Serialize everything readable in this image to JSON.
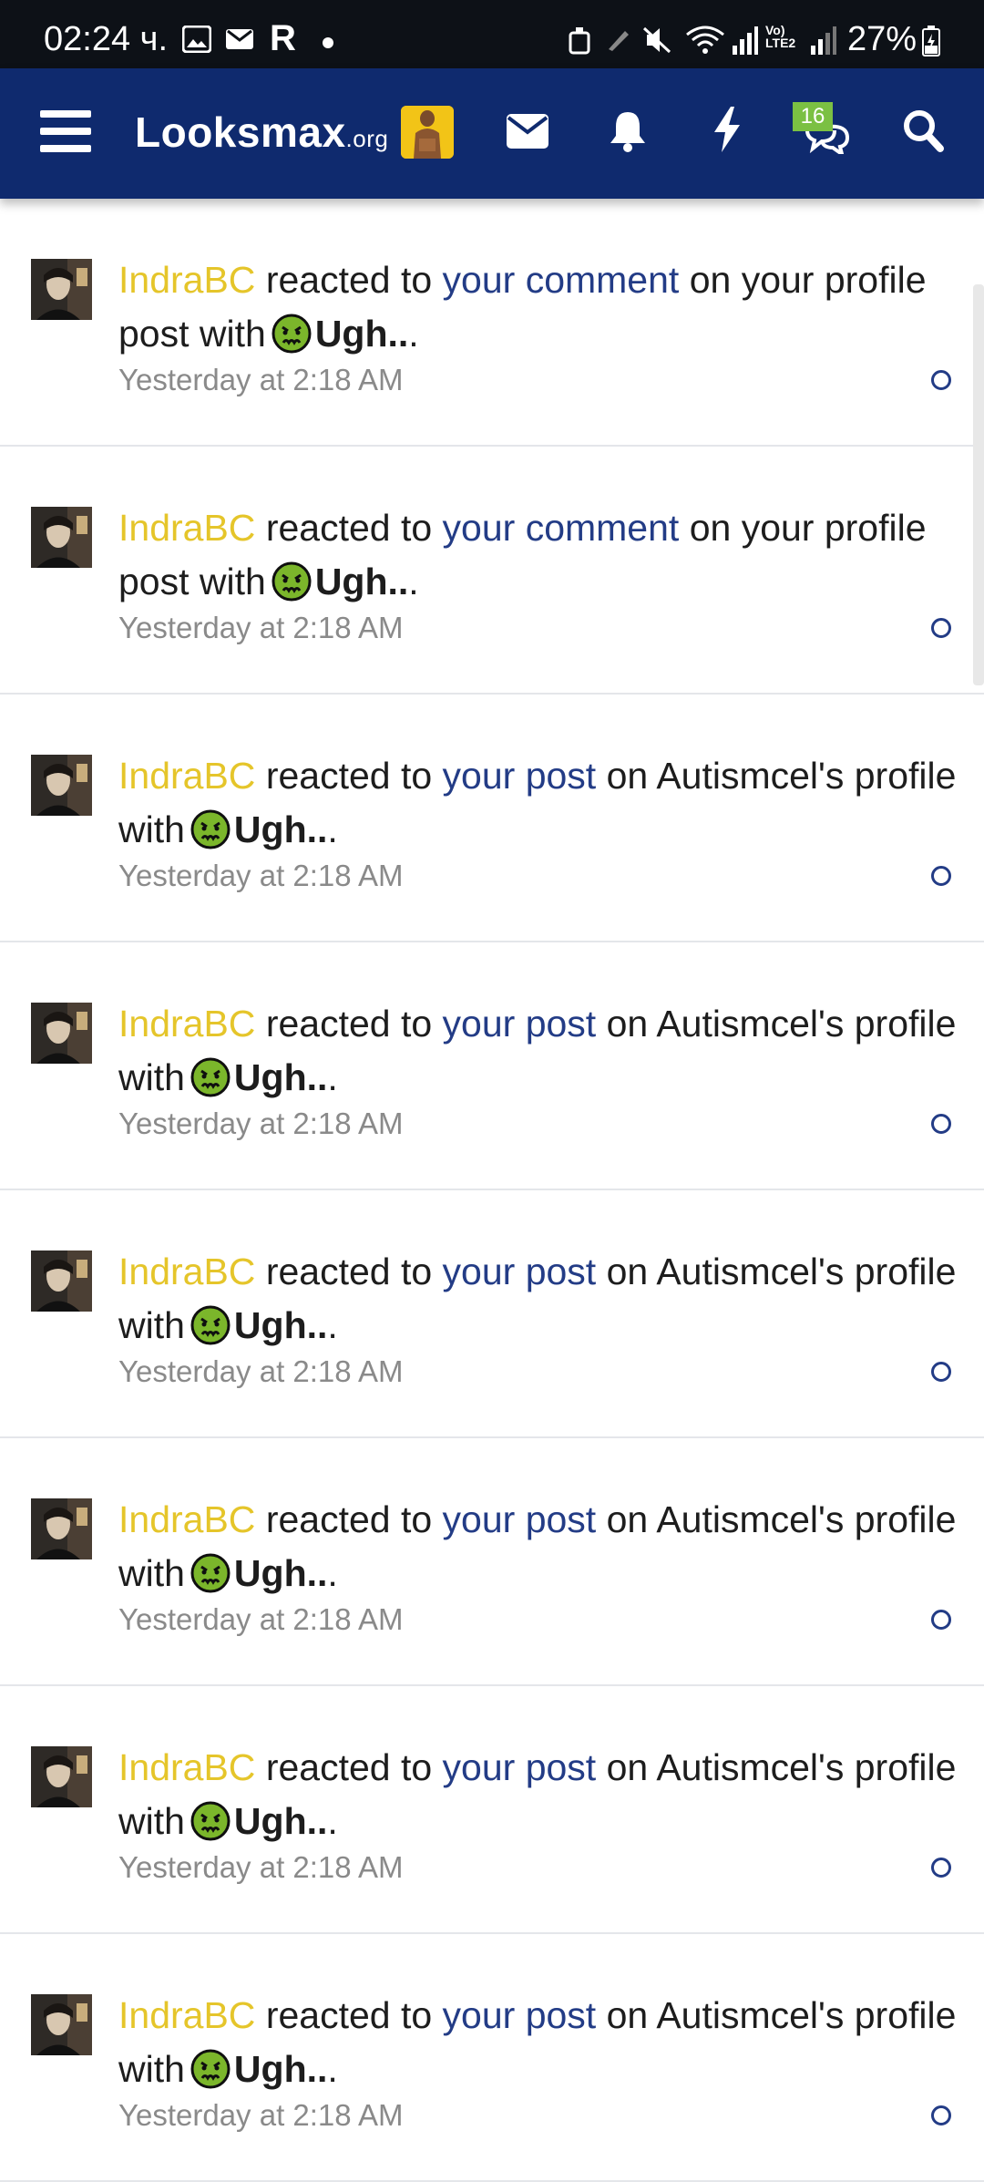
{
  "status_bar": {
    "time": "02:24 ч.",
    "battery": "27%",
    "r_glyph": "R",
    "icons": [
      "image-icon",
      "mail-notification-icon",
      "r-icon",
      "dot-icon",
      "lock-icon",
      "pen-icon",
      "mute-icon",
      "wifi-icon",
      "signal-icon",
      "volte-icon",
      "signal-icon",
      "battery-icon"
    ]
  },
  "nav": {
    "logo_main": "Looksmax",
    "logo_tld": ".org",
    "chat_badge": "16",
    "icons": [
      "menu-icon",
      "avatar",
      "envelope-icon",
      "bell-icon",
      "lightning-icon",
      "chat-icon",
      "search-icon"
    ]
  },
  "colors": {
    "nav_bg": "#0f2a6e",
    "username": "#e5c52a",
    "link": "#233c86",
    "emoji_green": "#7bb62b"
  },
  "alerts": [
    {
      "user": "IndraBC",
      "before": " reacted to ",
      "link": "your comment",
      "after": " on your profile post with",
      "reaction": "Ugh..",
      "trail": ".",
      "time": "Yesterday at 2:18 AM"
    },
    {
      "user": "IndraBC",
      "before": " reacted to ",
      "link": "your comment",
      "after": " on your profile post with",
      "reaction": "Ugh..",
      "trail": ".",
      "time": "Yesterday at 2:18 AM"
    },
    {
      "user": "IndraBC",
      "before": " reacted to ",
      "link": "your post",
      "after": " on Autismcel's profile with",
      "reaction": "Ugh..",
      "trail": ".",
      "time": "Yesterday at 2:18 AM"
    },
    {
      "user": "IndraBC",
      "before": " reacted to ",
      "link": "your post",
      "after": " on Autismcel's profile with",
      "reaction": "Ugh..",
      "trail": ".",
      "time": "Yesterday at 2:18 AM"
    },
    {
      "user": "IndraBC",
      "before": " reacted to ",
      "link": "your post",
      "after": " on Autismcel's profile with",
      "reaction": "Ugh..",
      "trail": ".",
      "time": "Yesterday at 2:18 AM"
    },
    {
      "user": "IndraBC",
      "before": " reacted to ",
      "link": "your post",
      "after": " on Autismcel's profile with",
      "reaction": "Ugh..",
      "trail": ".",
      "time": "Yesterday at 2:18 AM"
    },
    {
      "user": "IndraBC",
      "before": " reacted to ",
      "link": "your post",
      "after": " on Autismcel's profile with",
      "reaction": "Ugh..",
      "trail": ".",
      "time": "Yesterday at 2:18 AM"
    },
    {
      "user": "IndraBC",
      "before": " reacted to ",
      "link": "your post",
      "after": " on Autismcel's profile with",
      "reaction": "Ugh..",
      "trail": ".",
      "time": "Yesterday at 2:18 AM"
    }
  ]
}
